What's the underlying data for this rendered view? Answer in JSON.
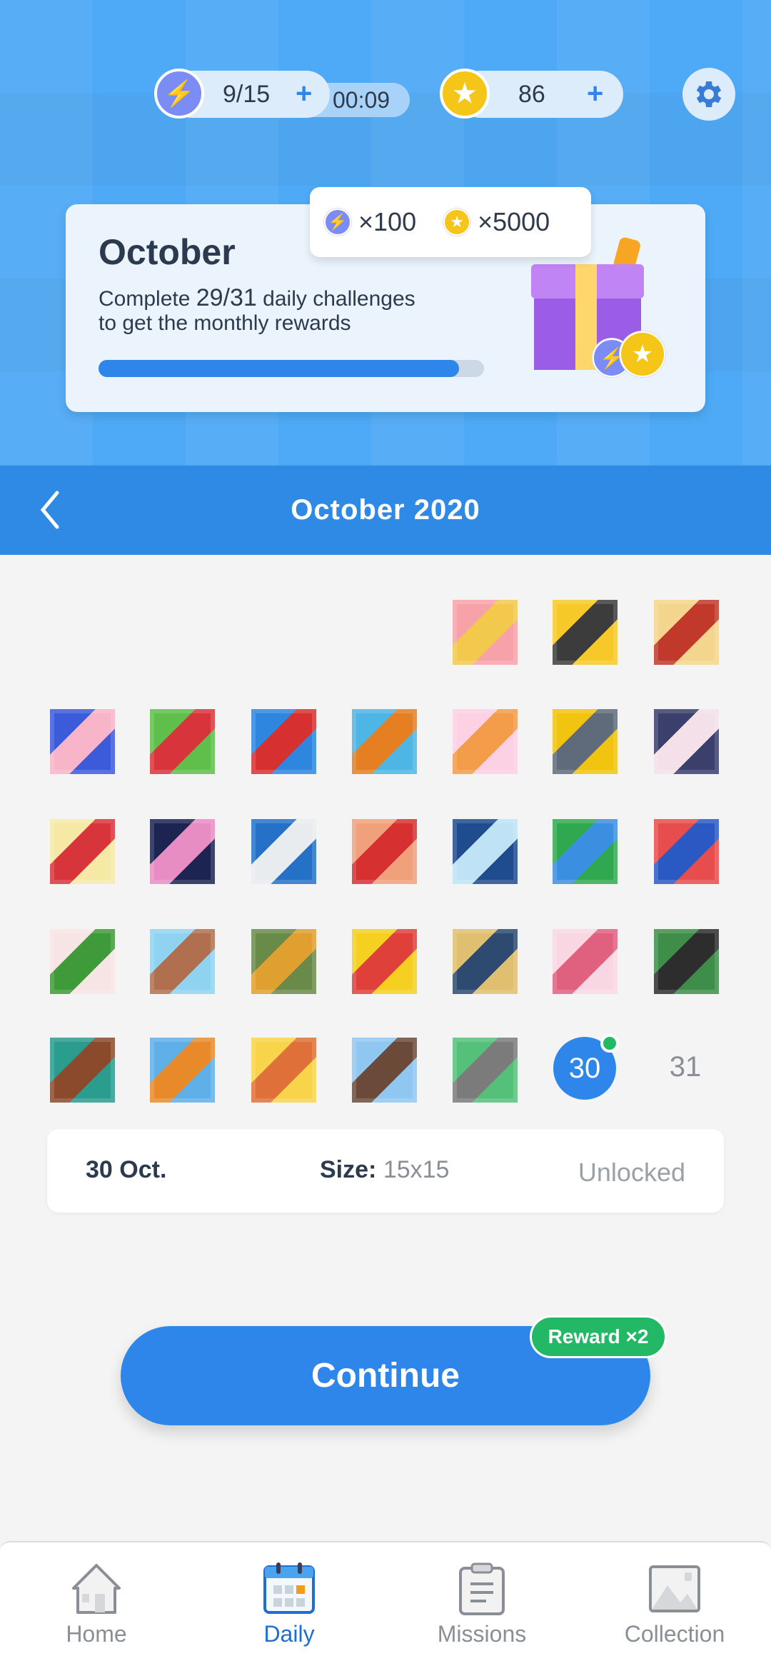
{
  "status": {
    "energy": "9/15",
    "energy_plus": "+",
    "timer": "00:09",
    "coins": "86",
    "coins_plus": "+"
  },
  "monthly": {
    "title": "October",
    "line1_prefix": "Complete ",
    "line1_count": "29/31",
    "line1_suffix": " daily challenges",
    "line2": "to get the monthly rewards",
    "progress": 0.935,
    "reward_energy": "×100",
    "reward_coins": "×5000"
  },
  "calendar": {
    "title": "October 2020",
    "selected_day": "30",
    "next_day": "31",
    "tiles": [
      [
        "#f7a1a8",
        "#f2c94c"
      ],
      [
        "#f6c928",
        "#3c3c3c"
      ],
      [
        "#f4d58d",
        "#c0392b"
      ],
      [
        "#3b5bdb",
        "#f8b4c9"
      ],
      [
        "#5fbf4a",
        "#d8343b"
      ],
      [
        "#2e86de",
        "#d63031"
      ],
      [
        "#4db6e4",
        "#e67e22"
      ],
      [
        "#fbd1e3",
        "#f39c4a"
      ],
      [
        "#f1c40f",
        "#5f6b7a"
      ],
      [
        "#3a3f6b",
        "#f3e0e8"
      ],
      [
        "#f6e9a6",
        "#d8343b"
      ],
      [
        "#1c2451",
        "#e88cc4"
      ],
      [
        "#2471c7",
        "#e9ecef"
      ],
      [
        "#f0a07a",
        "#d63031"
      ],
      [
        "#1f4c8f",
        "#bfe3f5"
      ],
      [
        "#2fa84f",
        "#3b8fe0"
      ],
      [
        "#e84d4d",
        "#2b59c3"
      ],
      [
        "#f7e4e4",
        "#3f9b3a"
      ],
      [
        "#8fd3f0",
        "#b07050"
      ],
      [
        "#6a8a4a",
        "#e0a030"
      ],
      [
        "#f5d020",
        "#e0403a"
      ],
      [
        "#e0c070",
        "#2e4a70"
      ],
      [
        "#f8d7e3",
        "#e06080"
      ],
      [
        "#3e8e4a",
        "#2d2d2d"
      ],
      [
        "#2a9d8f",
        "#8b4a2b"
      ],
      [
        "#5fb0e8",
        "#e88a2a"
      ],
      [
        "#f7d44a",
        "#e0703a"
      ],
      [
        "#8fc7f0",
        "#6b4a3a"
      ],
      [
        "#54c07a",
        "#7b7b7b"
      ]
    ]
  },
  "selected": {
    "date": "30 Oct.",
    "size_label": "Size:",
    "size_value": "15x15",
    "state": "Unlocked"
  },
  "continue": {
    "label": "Continue",
    "badge": "Reward ×2"
  },
  "nav": [
    {
      "label": "Home",
      "icon": "home-icon"
    },
    {
      "label": "Daily",
      "icon": "calendar-icon"
    },
    {
      "label": "Missions",
      "icon": "clipboard-icon"
    },
    {
      "label": "Collection",
      "icon": "image-icon"
    }
  ],
  "colors": {
    "accent": "#2f86ea",
    "energy": "#7b8cf5",
    "coin": "#f5c518",
    "reward": "#22b866"
  }
}
